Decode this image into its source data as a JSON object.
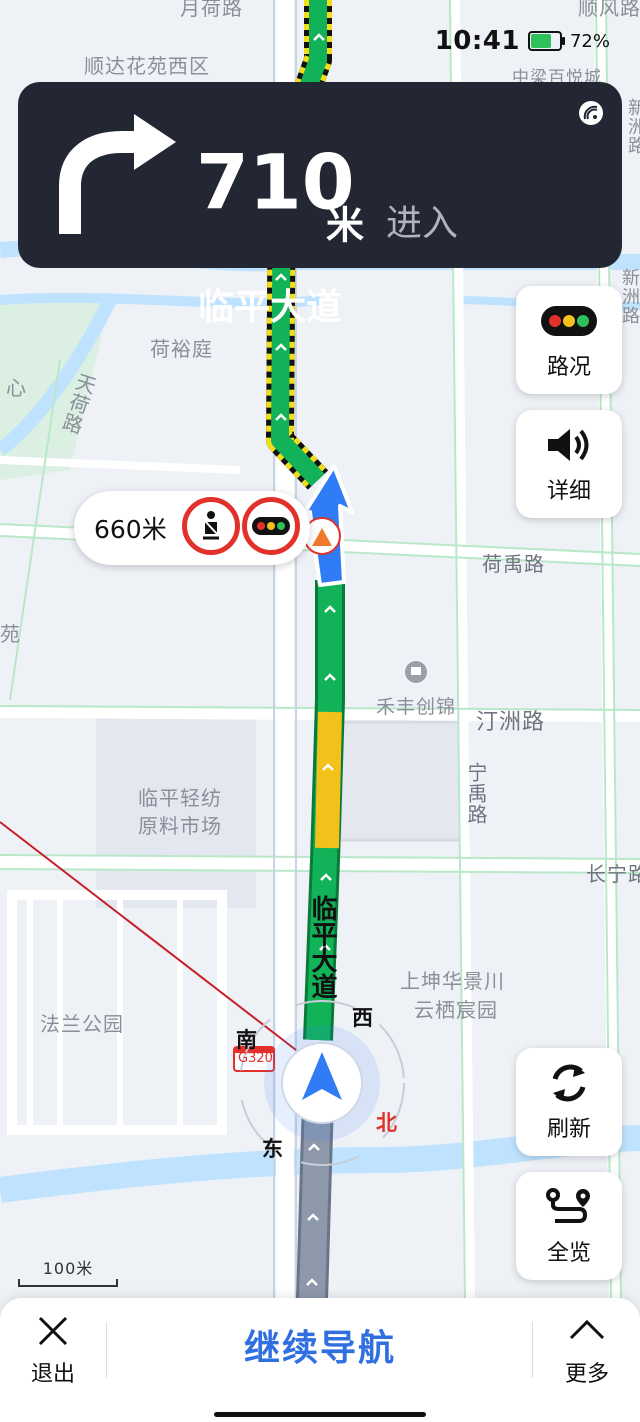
{
  "status_bar": {
    "time": "10:41",
    "battery_level": 0.72,
    "battery_text": "72%"
  },
  "guidance": {
    "maneuver_icon": "turn-right-arrow-icon",
    "distance_value": "710",
    "distance_unit": "米",
    "action": "进入",
    "road_name": "临平大道",
    "signal_icon": "gps-signal-icon"
  },
  "alert": {
    "distance": "660米",
    "signs": [
      "seatbelt-sign-icon",
      "traffic-light-sign-icon"
    ],
    "road_work_icon": "road-work-icon"
  },
  "side_buttons": [
    {
      "label": "路况",
      "icon": "traffic-light-icon"
    },
    {
      "label": "详细",
      "icon": "speaker-icon"
    },
    {
      "label": "刷新",
      "icon": "refresh-icon"
    },
    {
      "label": "全览",
      "icon": "route-overview-icon"
    }
  ],
  "map_labels": {
    "yuehelu": "月荷路",
    "shunfeng": "顺风路",
    "shunda": "顺达花苑西区",
    "zhongliang": "中梁百悦城",
    "xinzhou_top": "新洲路",
    "xinzhou_right": "新洲路",
    "heyuting": "荷裕庭",
    "tianhelu": "天荷路",
    "xin": "心",
    "heyulu": "荷禹路",
    "fan": "苑",
    "hefengchuangjin": "禾丰创锦",
    "tingzhoulu": "汀洲路",
    "ningyulu": "宁禹路",
    "linping_market_1": "临平轻纺",
    "linping_market_2": "原料市场",
    "changning": "长宁路",
    "main_road": "临平大道",
    "shangkun_1": "上坤华景川",
    "shangkun_2": "云栖宸园",
    "falan": "法兰公园",
    "g320": "G320"
  },
  "compass": {
    "south": "南",
    "west": "西",
    "east": "东",
    "north": "北"
  },
  "scale": {
    "text": "100米"
  },
  "bottom_bar": {
    "exit": "退出",
    "continue": "继续导航",
    "more": "更多"
  },
  "colors": {
    "route_green": "#12b358",
    "route_yellow": "#f2c21b",
    "route_passed": "#8d98ab",
    "accent_blue": "#2f6fe0",
    "panel_dark": "#222733"
  }
}
